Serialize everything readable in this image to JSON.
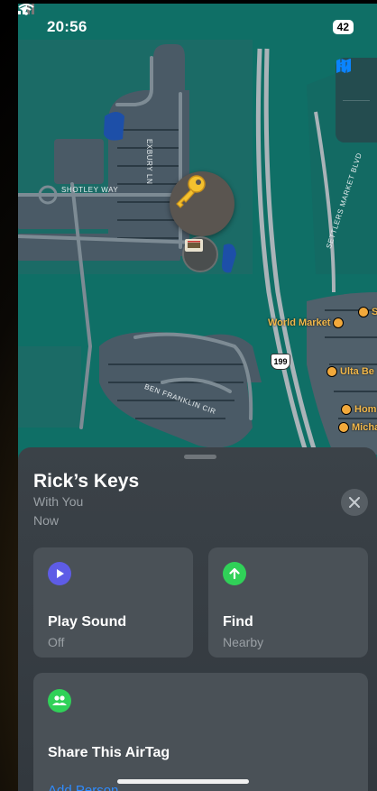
{
  "status_bar": {
    "time": "20:56",
    "battery": "42"
  },
  "map": {
    "streets": [
      "SHOTLEY WAY",
      "EXBURY LN",
      "SETTLERS MARKET BLVD",
      "BEN FRANKLIN CIR"
    ],
    "route_shield": "199",
    "pois": [
      "World Market",
      "S",
      "Ulta Be",
      "Hom",
      "Micha"
    ]
  },
  "item": {
    "name": "Rick’s Keys",
    "location": "With You",
    "time": "Now"
  },
  "actions": {
    "play_sound": {
      "label": "Play Sound",
      "value": "Off",
      "color": "#5e5ce6"
    },
    "find": {
      "label": "Find",
      "value": "Nearby",
      "color": "#30d158"
    },
    "share": {
      "label": "Share This AirTag",
      "link": "Add Person",
      "color": "#30d158"
    }
  },
  "colors": {
    "map_water": "#0f6f66",
    "link": "#2f8cff",
    "accent_blue": "#0a84ff"
  }
}
